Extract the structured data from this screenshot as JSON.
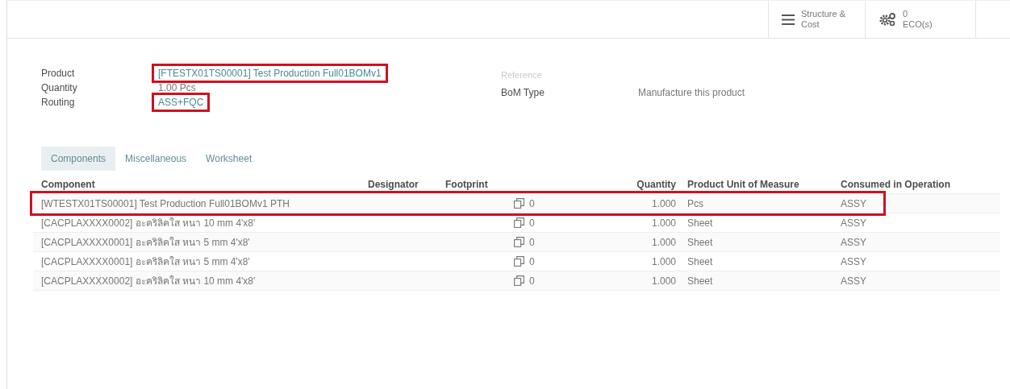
{
  "toolbar": {
    "buttons": [
      {
        "kind": "menu",
        "label": "Structure &",
        "sublabel": "Cost"
      },
      {
        "kind": "gears",
        "label": "0",
        "sublabel": "ECO(s)"
      }
    ]
  },
  "form": {
    "left": [
      {
        "label": "Product",
        "value": "[FTESTX01TS00001] Test Production Full01BOMv1",
        "link": true,
        "highlighted": true
      },
      {
        "label": "Quantity",
        "value": "1.00 Pcs",
        "link": false,
        "highlighted": false
      },
      {
        "label": "Routing",
        "value": "ASS+FQC",
        "link": true,
        "highlighted": true
      }
    ],
    "right": [
      {
        "label": "Reference",
        "muted": true
      },
      {
        "label": "BoM Type",
        "value": "Manufacture this product",
        "muted": false
      }
    ]
  },
  "tabs": [
    {
      "label": "Components",
      "selected": true
    },
    {
      "label": "Miscellaneous",
      "selected": false
    },
    {
      "label": "Worksheet",
      "selected": false
    }
  ],
  "table": {
    "columns": {
      "component": "Component",
      "designator": "Designator",
      "footprint": "Footprint",
      "quantity": "Quantity",
      "uom": "Product Unit of Measure",
      "operation": "Consumed in Operation"
    },
    "rows": [
      {
        "component": "[WTESTX01TS00001] Test Production Full01BOMv1 PTH",
        "count": "0",
        "quantity": "1.000",
        "uom": "Pcs",
        "operation": "ASSY",
        "highlighted": true
      },
      {
        "component": "[CACPLAXXXX0002] อะคริลิคใส หนา 10 mm 4'x8'",
        "count": "0",
        "quantity": "1.000",
        "uom": "Sheet",
        "operation": "ASSY",
        "highlighted": false
      },
      {
        "component": "[CACPLAXXXX0001] อะคริลิคใส หนา 5 mm 4'x8'",
        "count": "0",
        "quantity": "1.000",
        "uom": "Sheet",
        "operation": "ASSY",
        "highlighted": false
      },
      {
        "component": "[CACPLAXXXX0001] อะคริลิคใส หนา 5 mm 4'x8'",
        "count": "0",
        "quantity": "1.000",
        "uom": "Sheet",
        "operation": "ASSY",
        "highlighted": false
      },
      {
        "component": "[CACPLAXXXX0002] อะคริลิคใส หนา 10 mm 4'x8'",
        "count": "0",
        "quantity": "1.000",
        "uom": "Sheet",
        "operation": "ASSY",
        "highlighted": false
      }
    ]
  }
}
